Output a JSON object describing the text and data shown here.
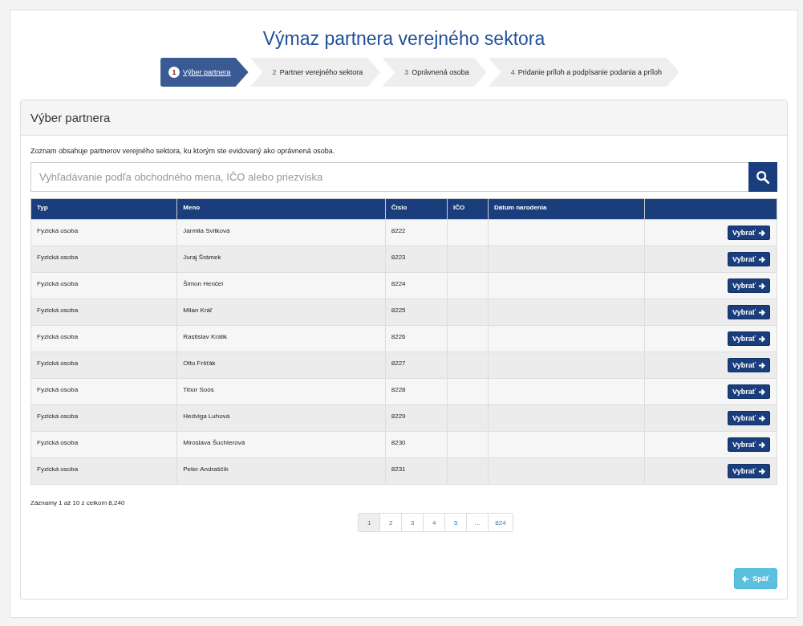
{
  "title": "Výmaz partnera verejného sektora",
  "steps": [
    {
      "number": "1",
      "label": "Výber partnera",
      "selected": true
    },
    {
      "number": "2",
      "label": "Partner verejného sektora",
      "selected": false
    },
    {
      "number": "3",
      "label": "Oprávnená osoba",
      "selected": false
    },
    {
      "number": "4",
      "label": "Pridanie príloh a podpísanie podania a príloh",
      "selected": false
    }
  ],
  "panel": {
    "title": "Výber partnera",
    "description": "Zoznam obsahuje partnerov verejného sektora, ku ktorým ste evidovaný ako oprávnená osoba.",
    "search": {
      "placeholder": "Vyhľadávanie podľa obchodného mena, IČO alebo priezviska"
    },
    "table": {
      "columns": [
        "Typ",
        "Meno",
        "Číslo",
        "IČO",
        "Dátum narodenia"
      ],
      "rows": [
        {
          "typ": "Fyzická osoba",
          "meno": "Jarmila Svitková",
          "cislo": "8222",
          "action": "Vybrať"
        },
        {
          "typ": "Fyzická osoba",
          "meno": "Juraj Šrámek",
          "cislo": "8223",
          "action": "Vybrať"
        },
        {
          "typ": "Fyzická osoba",
          "meno": "Šimon Henčel",
          "cislo": "8224",
          "action": "Vybrať"
        },
        {
          "typ": "Fyzická osoba",
          "meno": "Milan Kráľ",
          "cislo": "8225",
          "action": "Vybrať"
        },
        {
          "typ": "Fyzická osoba",
          "meno": "Rastislav Králik",
          "cislo": "8226",
          "action": "Vybrať"
        },
        {
          "typ": "Fyzická osoba",
          "meno": "Otto Fršťák",
          "cislo": "8227",
          "action": "Vybrať"
        },
        {
          "typ": "Fyzická osoba",
          "meno": "Tibor Soós",
          "cislo": "8228",
          "action": "Vybrať"
        },
        {
          "typ": "Fyzická osoba",
          "meno": "Hedviga Luhová",
          "cislo": "8229",
          "action": "Vybrať"
        },
        {
          "typ": "Fyzická osoba",
          "meno": "Miroslava Šuchterová",
          "cislo": "8230",
          "action": "Vybrať"
        },
        {
          "typ": "Fyzická osoba",
          "meno": "Peter Andraščík",
          "cislo": "8231",
          "action": "Vybrať"
        }
      ]
    },
    "records_info": "Záznamy 1 až 10 z celkom 8,240",
    "pagination": [
      {
        "label": "1",
        "selected": true
      },
      {
        "label": "2",
        "selected": false
      },
      {
        "label": "3",
        "selected": false
      },
      {
        "label": "4",
        "selected": false
      },
      {
        "label": "5",
        "selected": false
      },
      {
        "label": "…",
        "selected": false
      },
      {
        "label": "824",
        "selected": false
      }
    ],
    "back_button": "Späť"
  }
}
